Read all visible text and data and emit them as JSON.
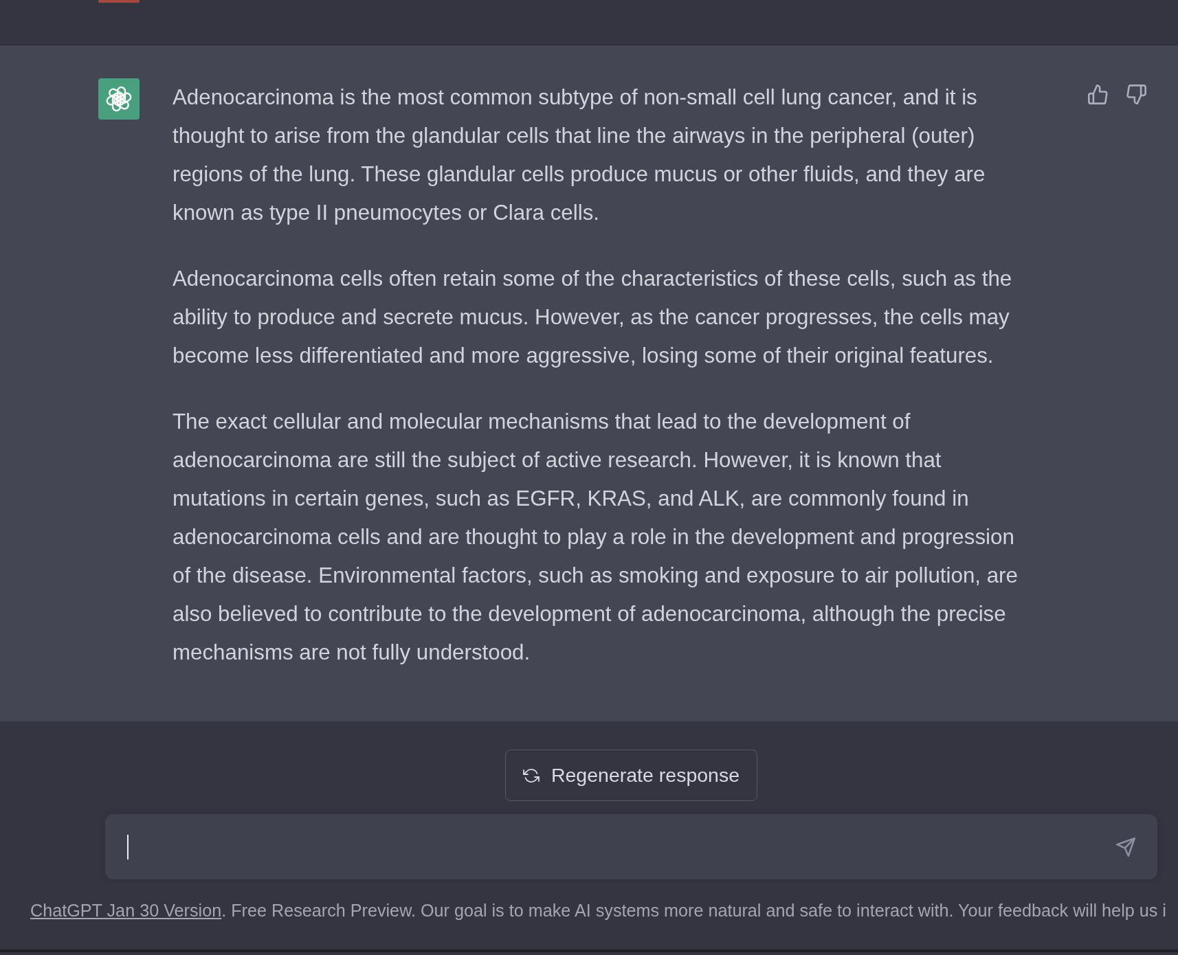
{
  "message": {
    "paragraphs": [
      "Adenocarcinoma is the most common subtype of non-small cell lung cancer, and it is thought to arise from the glandular cells that line the airways in the peripheral (outer) regions of the lung. These glandular cells produce mucus or other fluids, and they are known as type II pneumocytes or Clara cells.",
      "Adenocarcinoma cells often retain some of the characteristics of these cells, such as the ability to produce and secrete mucus. However, as the cancer progresses, the cells may become less differentiated and more aggressive, losing some of their original features.",
      "The exact cellular and molecular mechanisms that lead to the development of adenocarcinoma are still the subject of active research. However, it is known that mutations in certain genes, such as EGFR, KRAS, and ALK, are commonly found in adenocarcinoma cells and are thought to play a role in the development and progression of the disease. Environmental factors, such as smoking and exposure to air pollution, are also believed to contribute to the development of adenocarcinoma, although the precise mechanisms are not fully understood."
    ]
  },
  "regenerate_button": {
    "label": "Regenerate response"
  },
  "footer": {
    "link": "ChatGPT Jan 30 Version",
    "text": ". Free Research Preview. Our goal is to make AI systems more natural and safe to interact with. Your feedback will help us i"
  }
}
